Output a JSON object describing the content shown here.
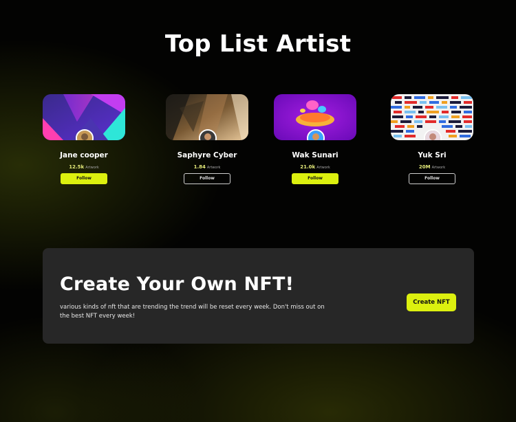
{
  "section": {
    "title": "Top List Artist"
  },
  "artists": [
    {
      "name": "Jane cooper",
      "count": "12.5k",
      "unit": "Artwork",
      "follow_label": "Follow",
      "follow_style": "filled",
      "cover": "geometric-gradient"
    },
    {
      "name": "Saphyre Cyber",
      "count": "1.84",
      "unit": "Artwork",
      "follow_label": "Follow",
      "follow_style": "outline",
      "cover": "blurred-abstract"
    },
    {
      "name": "Wak Sunari",
      "count": "21.0k",
      "unit": "Artwork",
      "follow_label": "Follow",
      "follow_style": "filled",
      "cover": "3d-figure-purple"
    },
    {
      "name": "Yuk Sri",
      "count": "20M",
      "unit": "Artwork",
      "follow_label": "Follow",
      "follow_style": "outline",
      "cover": "pixel-mosaic"
    }
  ],
  "cta": {
    "title": "Create Your Own NFT!",
    "description": "various kinds of nft that are trending the trend will be reset every week. Don't miss out on the best NFT every week!",
    "button_label": "Create NFT"
  },
  "colors": {
    "accent": "#dcf00f",
    "background": "#030302",
    "panel": "#272727",
    "count": "#e6ec7a"
  }
}
